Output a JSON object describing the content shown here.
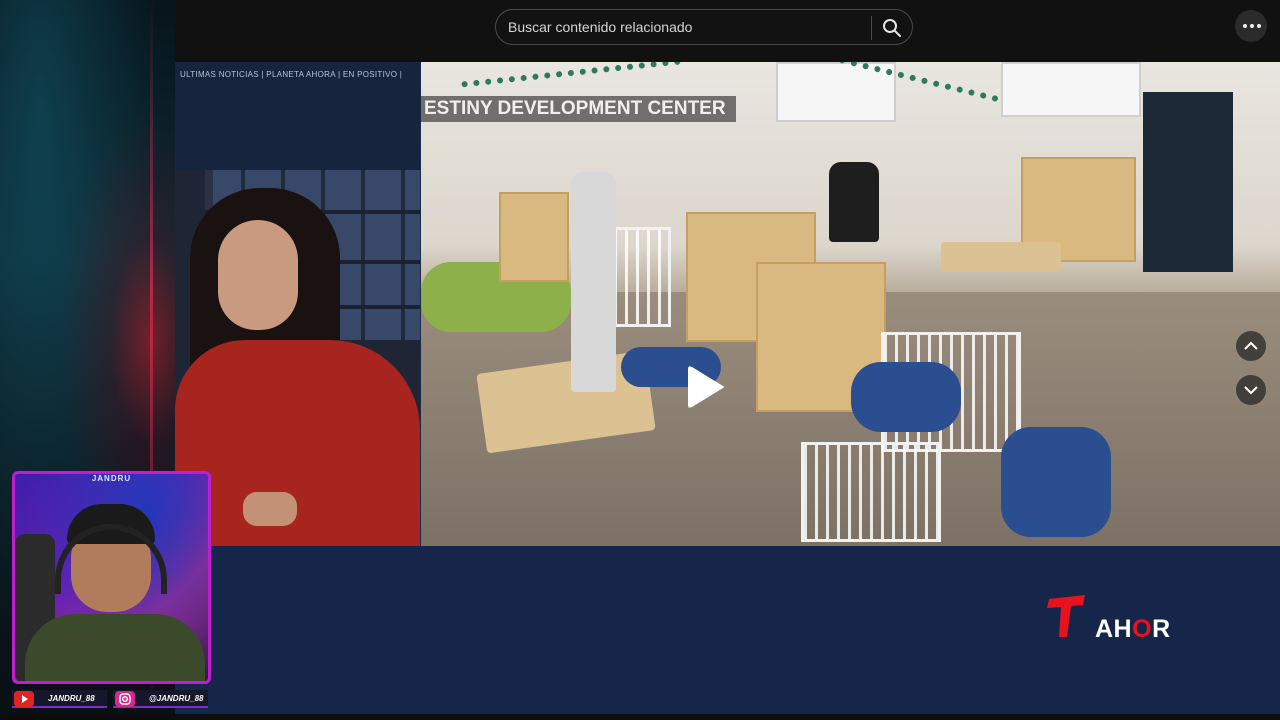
{
  "search": {
    "placeholder": "Buscar contenido relacionado"
  },
  "video": {
    "ticker": "ULTIMAS NOTICIAS | PLANETA AHORA | EN POSITIVO |",
    "caption": "ESTINY DEVELOPMENT CENTER",
    "logo_text_pre": "AH",
    "logo_text_o": "O",
    "logo_text_post": "R"
  },
  "overlay": {
    "cam_label": "JANDRU",
    "socials": [
      {
        "icon": "youtube-icon",
        "handle": "JANDRU_88",
        "color": "#e02424"
      },
      {
        "icon": "instagram-icon",
        "handle": "@JANDRU_88",
        "color": "#d62a8a"
      }
    ]
  },
  "colors": {
    "brand_red": "#e8121e",
    "stream_frame": "#c01fd0",
    "news_band": "#15264a"
  }
}
